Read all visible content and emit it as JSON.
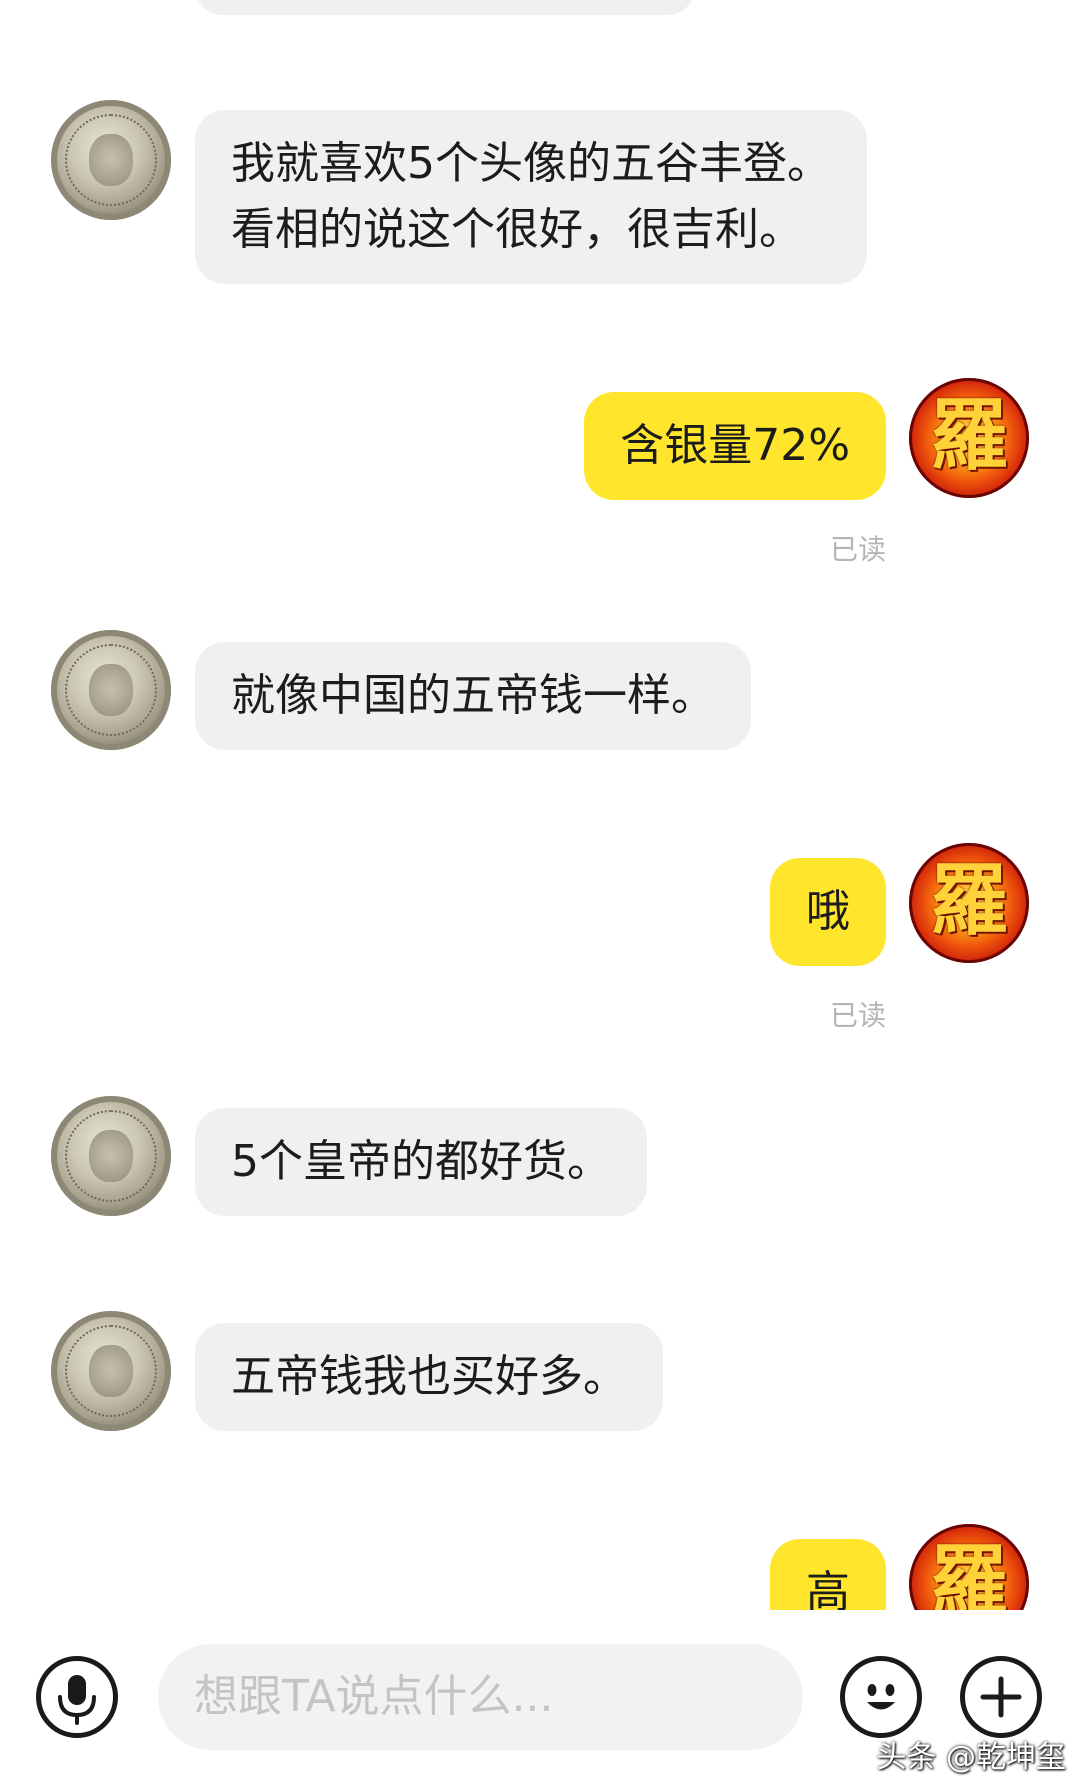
{
  "messages": [
    {
      "side": "in",
      "text": "我就喜欢5个头像的五谷丰登。\n看相的说这个很好，很吉利。"
    },
    {
      "side": "out",
      "text": "含银量72%",
      "read": "已读"
    },
    {
      "side": "in",
      "text": "就像中国的五帝钱一样。"
    },
    {
      "side": "out",
      "text": "哦",
      "read": "已读"
    },
    {
      "side": "in",
      "text": "5个皇帝的都好货。"
    },
    {
      "side": "in",
      "text": "五帝钱我也买好多。"
    },
    {
      "side": "out",
      "text": "高"
    }
  ],
  "avatars": {
    "other": "silver-coin-avatar",
    "self": "seal-character-avatar",
    "self_glyph": "羅"
  },
  "input_bar": {
    "placeholder": "想跟TA说点什么...",
    "voice_icon": "microphone-icon",
    "emoji_icon": "emoji-icon",
    "plus_icon": "plus-icon"
  },
  "watermark": "头条 @乾坤玺",
  "colors": {
    "incoming_bubble": "#f0f0f2",
    "outgoing_bubble": "#ffe52b",
    "read_receipt": "#b5b5b5"
  }
}
